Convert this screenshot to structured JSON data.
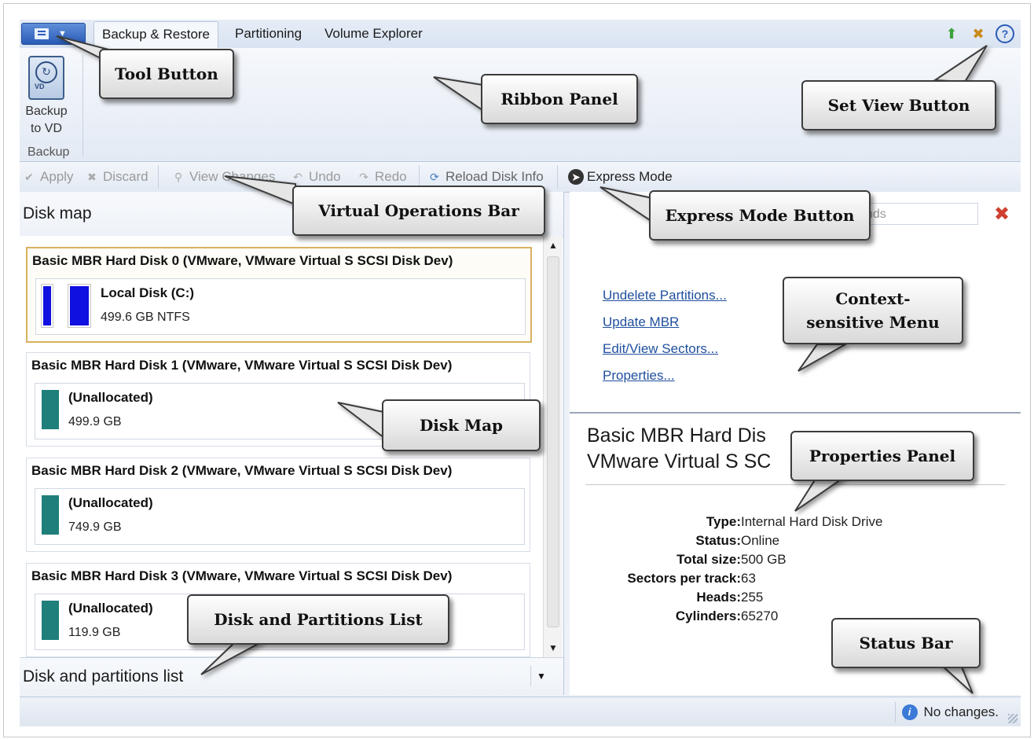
{
  "tabs": [
    "Backup & Restore",
    "Partitioning",
    "Volume Explorer"
  ],
  "ribbon": {
    "button_label": "Backup\nto VD",
    "vd_icon_text": "VD",
    "group_label": "Backup"
  },
  "ops": {
    "apply": "Apply",
    "discard": "Discard",
    "view_changes": "View Changes",
    "undo": "Undo",
    "redo": "Redo",
    "reload": "Reload Disk Info",
    "express": "Express Mode"
  },
  "disk_map": {
    "title": "Disk map",
    "disks": [
      {
        "title": "Basic MBR Hard Disk 0 (VMware, VMware Virtual S SCSI Disk Dev)",
        "name": "Local Disk (C:)",
        "size": "499.6 GB NTFS",
        "color": "#1010e0"
      },
      {
        "title": "Basic MBR Hard Disk 1 (VMware, VMware Virtual S SCSI Disk Dev)",
        "name": "(Unallocated)",
        "size": "499.9 GB",
        "color": "#1f7f7a"
      },
      {
        "title": "Basic MBR Hard Disk 2 (VMware, VMware Virtual S SCSI Disk Dev)",
        "name": "(Unallocated)",
        "size": "749.9 GB",
        "color": "#1f7f7a"
      },
      {
        "title": "Basic MBR Hard Disk 3 (VMware, VMware Virtual S SCSI Disk Dev)",
        "name": "(Unallocated)",
        "size": "119.9 GB",
        "color": "#1f7f7a"
      }
    ]
  },
  "partitions_list": {
    "title": "Disk and partitions list"
  },
  "context_menu": {
    "search_placeholder": "nds",
    "links": [
      "Undelete Partitions...",
      "Update MBR",
      "Edit/View Sectors...",
      "Properties..."
    ]
  },
  "properties": {
    "title_line1": "Basic MBR Hard Dis",
    "title_line2": "VMware Virtual S SC",
    "rows": [
      {
        "k": "Type:",
        "v": "Internal Hard Disk Drive"
      },
      {
        "k": "Status:",
        "v": "Online"
      },
      {
        "k": "Total size:",
        "v": "500 GB"
      },
      {
        "k": "Sectors per track:",
        "v": "63"
      },
      {
        "k": "Heads:",
        "v": "255"
      },
      {
        "k": "Cylinders:",
        "v": "65270"
      }
    ]
  },
  "status_bar": {
    "text": "No changes."
  },
  "callouts": {
    "tool_button": "Tool Button",
    "ribbon_panel": "Ribbon Panel",
    "set_view_button": "Set View Button",
    "virtual_ops_bar": "Virtual Operations Bar",
    "express_mode_button": "Express Mode Button",
    "context_menu": "Context-sensitive Menu",
    "disk_map": "Disk Map",
    "properties_panel": "Properties Panel",
    "partitions_list": "Disk and Partitions List",
    "status_bar": "Status Bar"
  }
}
